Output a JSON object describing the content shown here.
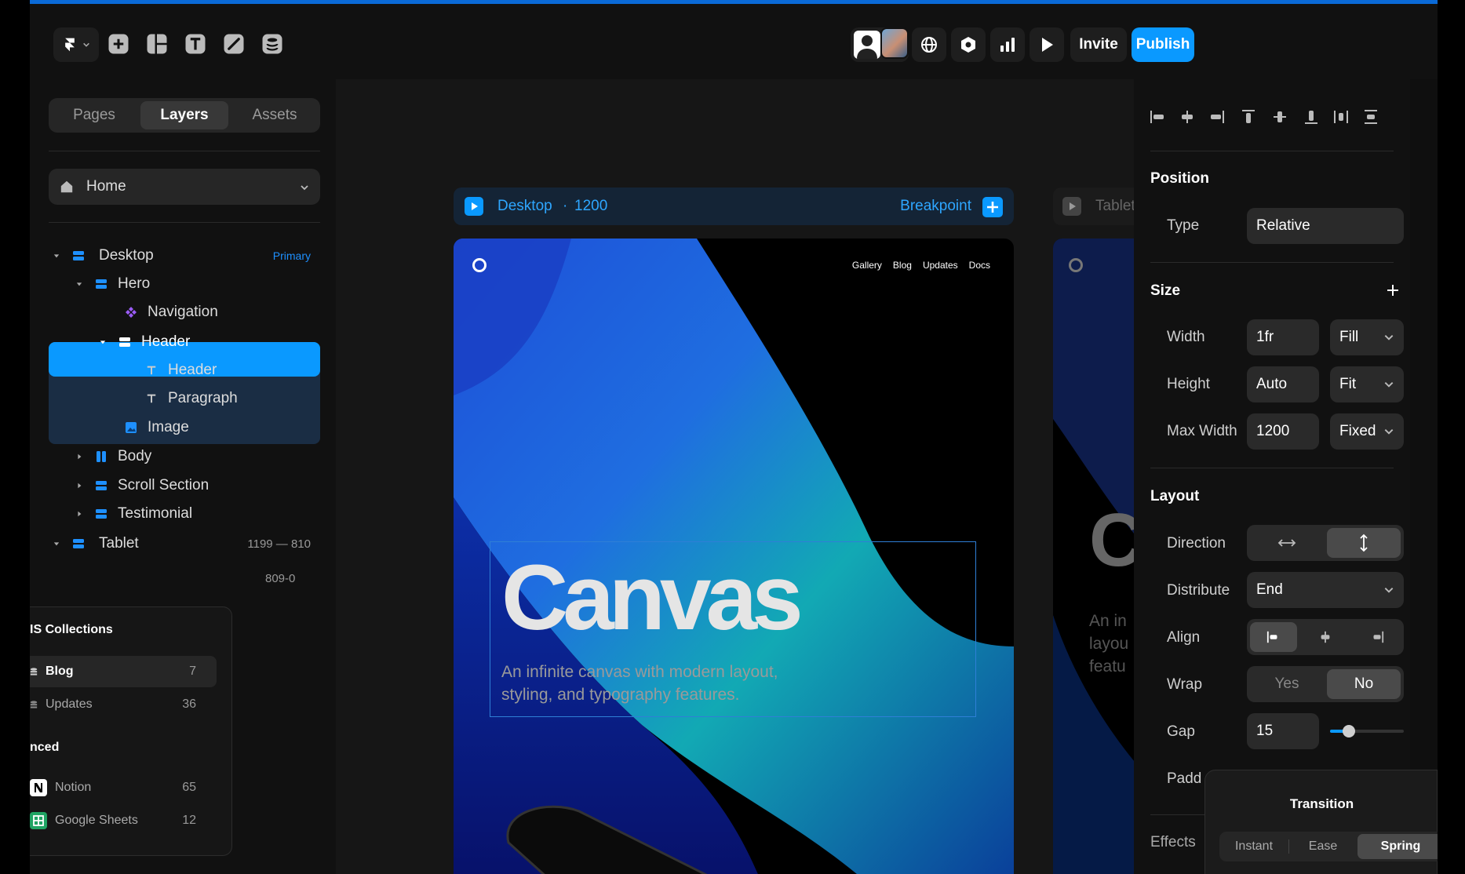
{
  "toolbar": {
    "invite_label": "Invite",
    "publish_label": "Publish"
  },
  "left": {
    "tabs": [
      "Pages",
      "Layers",
      "Assets"
    ],
    "page_select": "Home",
    "layers": {
      "desktop": "Desktop",
      "primary": "Primary",
      "hero": "Hero",
      "navigation": "Navigation",
      "header_group": "Header",
      "header_text": "Header",
      "paragraph": "Paragraph",
      "image": "Image",
      "body": "Body",
      "scroll_section": "Scroll Section",
      "testimonial": "Testimonial",
      "tablet": "Tablet",
      "tablet_range": "1199 — 810",
      "phone_range": "809-0"
    }
  },
  "cms": {
    "title": "IS Collections",
    "items": [
      {
        "name": "Blog",
        "count": "7"
      },
      {
        "name": "Updates",
        "count": "36"
      }
    ],
    "synced_title": "nced",
    "synced": [
      {
        "name": "Notion",
        "count": "65"
      },
      {
        "name": "Google Sheets",
        "count": "12"
      }
    ]
  },
  "canvas": {
    "breakpoint_name": "Desktop",
    "breakpoint_dot": "·",
    "breakpoint_width": "1200",
    "breakpoint_label": "Breakpoint",
    "tablet_label": "Tablet",
    "nav": [
      "Gallery",
      "Blog",
      "Updates",
      "Docs"
    ],
    "hero_title": "Canvas",
    "hero_line1": "An infinite canvas with modern layout,",
    "hero_line2": "styling, and typography features.",
    "tablet_title": "C",
    "tablet_sub": [
      "An in",
      "layou",
      "featu"
    ]
  },
  "props": {
    "position_title": "Position",
    "type_label": "Type",
    "type_value": "Relative",
    "size_title": "Size",
    "width_label": "Width",
    "width_value": "1fr",
    "width_mode": "Fill",
    "height_label": "Height",
    "height_value": "Auto",
    "height_mode": "Fit",
    "maxw_label": "Max Width",
    "maxw_value": "1200",
    "maxw_mode": "Fixed",
    "layout_title": "Layout",
    "direction_label": "Direction",
    "distribute_label": "Distribute",
    "distribute_value": "End",
    "align_label": "Align",
    "wrap_label": "Wrap",
    "wrap_yes": "Yes",
    "wrap_no": "No",
    "gap_label": "Gap",
    "gap_value": "15",
    "gap_slider_fraction": 0.25,
    "padding_label": "Padd",
    "effects_label": "Effects"
  },
  "transition": {
    "title": "Transition",
    "options": [
      "Instant",
      "Ease",
      "Spring"
    ]
  },
  "colors": {
    "accent": "#0a99ff",
    "panel": "#111111"
  }
}
